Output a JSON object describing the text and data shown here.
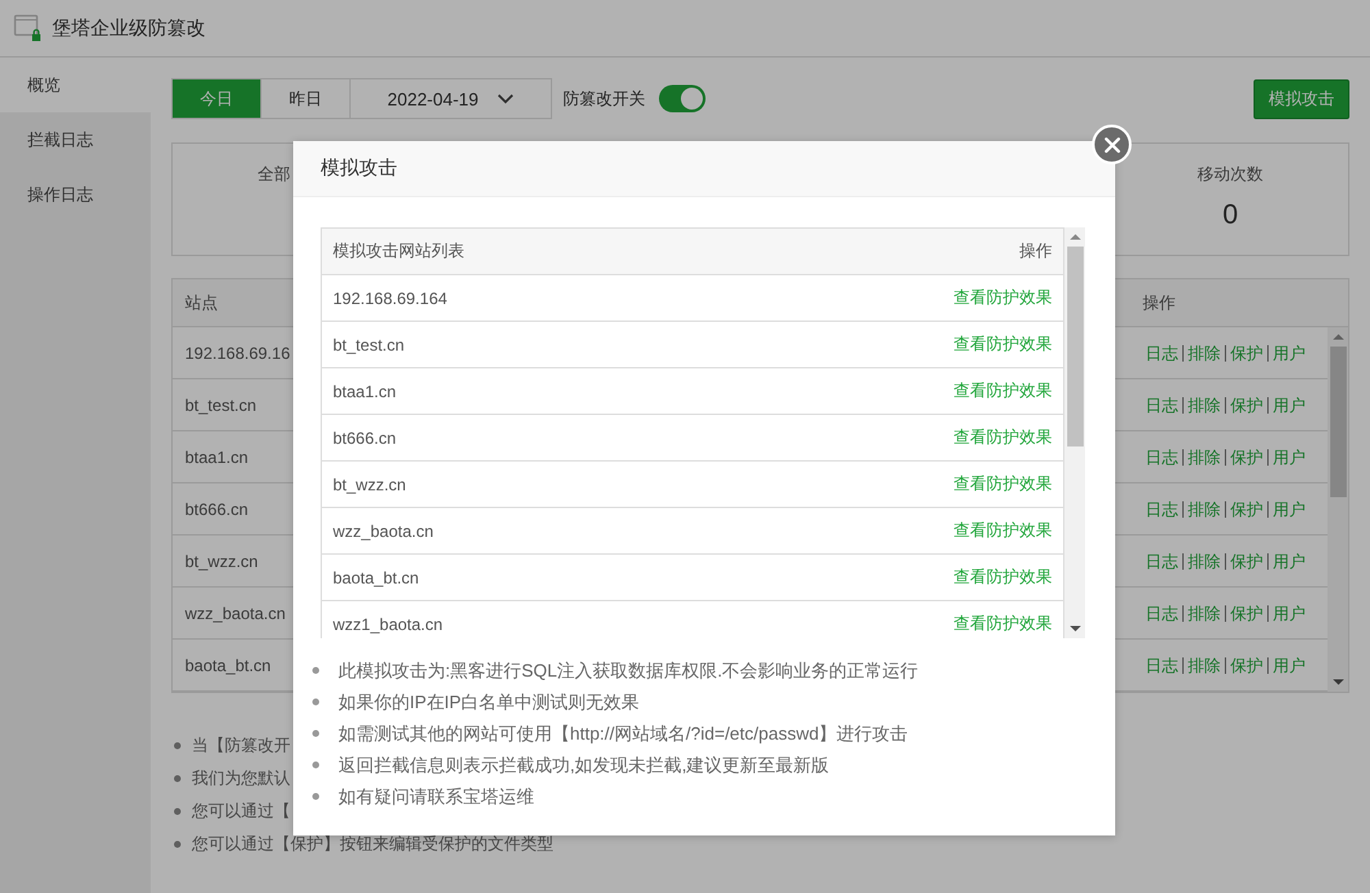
{
  "app": {
    "title": "堡塔企业级防篡改"
  },
  "sidebar": {
    "items": [
      {
        "label": "概览",
        "selected": true
      },
      {
        "label": "拦截日志",
        "selected": false
      },
      {
        "label": "操作日志",
        "selected": false
      }
    ]
  },
  "toolbar": {
    "day_tabs": [
      {
        "label": "今日",
        "selected": true
      },
      {
        "label": "昨日",
        "selected": false
      }
    ],
    "date": "2022-04-19",
    "switch": {
      "label": "防篡改开关",
      "on": true
    },
    "attack_button": "模拟攻击"
  },
  "stats": [
    {
      "label": "全部",
      "kind": "cut"
    },
    {
      "label": "移动次数",
      "value": "0",
      "kind": "full"
    }
  ],
  "sites_table": {
    "columns": [
      "站点",
      "操作"
    ],
    "rows": [
      {
        "site": "192.168.69.16",
        "actions": [
          "日志",
          "排除",
          "保护",
          "用户"
        ]
      },
      {
        "site": "bt_test.cn",
        "actions": [
          "日志",
          "排除",
          "保护",
          "用户"
        ]
      },
      {
        "site": "btaa1.cn",
        "actions": [
          "日志",
          "排除",
          "保护",
          "用户"
        ]
      },
      {
        "site": "bt666.cn",
        "actions": [
          "日志",
          "排除",
          "保护",
          "用户"
        ]
      },
      {
        "site": "bt_wzz.cn",
        "actions": [
          "日志",
          "排除",
          "保护",
          "用户"
        ]
      },
      {
        "site": "wzz_baota.cn",
        "actions": [
          "日志",
          "排除",
          "保护",
          "用户"
        ]
      },
      {
        "site": "baota_bt.cn",
        "actions": [
          "日志",
          "排除",
          "保护",
          "用户"
        ]
      }
    ]
  },
  "notes": [
    "当【防篡改开",
    "我们为您默认",
    "您可以通过【",
    "您可以通过【保护】按钮来编辑受保护的文件类型"
  ],
  "dialog": {
    "title": "模拟攻击",
    "columns": [
      "模拟攻击网站列表",
      "操作"
    ],
    "rows": [
      {
        "site": "192.168.69.164",
        "action": "查看防护效果"
      },
      {
        "site": "bt_test.cn",
        "action": "查看防护效果"
      },
      {
        "site": "btaa1.cn",
        "action": "查看防护效果"
      },
      {
        "site": "bt666.cn",
        "action": "查看防护效果"
      },
      {
        "site": "bt_wzz.cn",
        "action": "查看防护效果"
      },
      {
        "site": "wzz_baota.cn",
        "action": "查看防护效果"
      },
      {
        "site": "baota_bt.cn",
        "action": "查看防护效果"
      },
      {
        "site": "wzz1_baota.cn",
        "action": "查看防护效果"
      }
    ],
    "notes": [
      "此模拟攻击为:黑客进行SQL注入获取数据库权限.不会影响业务的正常运行",
      "如果你的IP在IP白名单中测试则无效果",
      "如需测试其他的网站可使用【http://网站域名/?id=/etc/passwd】进行攻击",
      "返回拦截信息则表示拦截成功,如发现未拦截,建议更新至最新版",
      "如有疑问请联系宝塔运维"
    ]
  }
}
